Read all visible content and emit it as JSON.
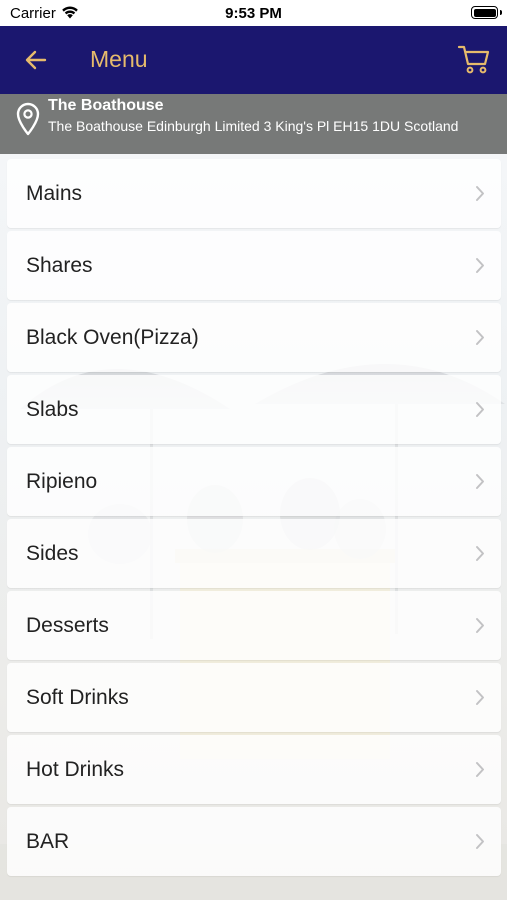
{
  "status_bar": {
    "carrier": "Carrier",
    "time": "9:53 PM"
  },
  "nav": {
    "title": "Menu",
    "back_icon": "arrow-left-icon",
    "cart_icon": "cart-icon"
  },
  "location": {
    "name": "The Boathouse",
    "address": "The Boathouse Edinburgh Limited 3 King's Pl EH15 1DU Scotland",
    "icon": "map-pin-icon"
  },
  "menu": {
    "items": [
      {
        "label": "Mains"
      },
      {
        "label": "Shares"
      },
      {
        "label": "Black Oven(Pizza)"
      },
      {
        "label": "Slabs"
      },
      {
        "label": "Ripieno"
      },
      {
        "label": "Sides"
      },
      {
        "label": "Desserts"
      },
      {
        "label": "Soft Drinks"
      },
      {
        "label": "Hot Drinks"
      },
      {
        "label": "BAR"
      }
    ]
  },
  "colors": {
    "nav_background": "#1b176f",
    "nav_accent": "#e6bb6c",
    "location_background": "#777978"
  }
}
